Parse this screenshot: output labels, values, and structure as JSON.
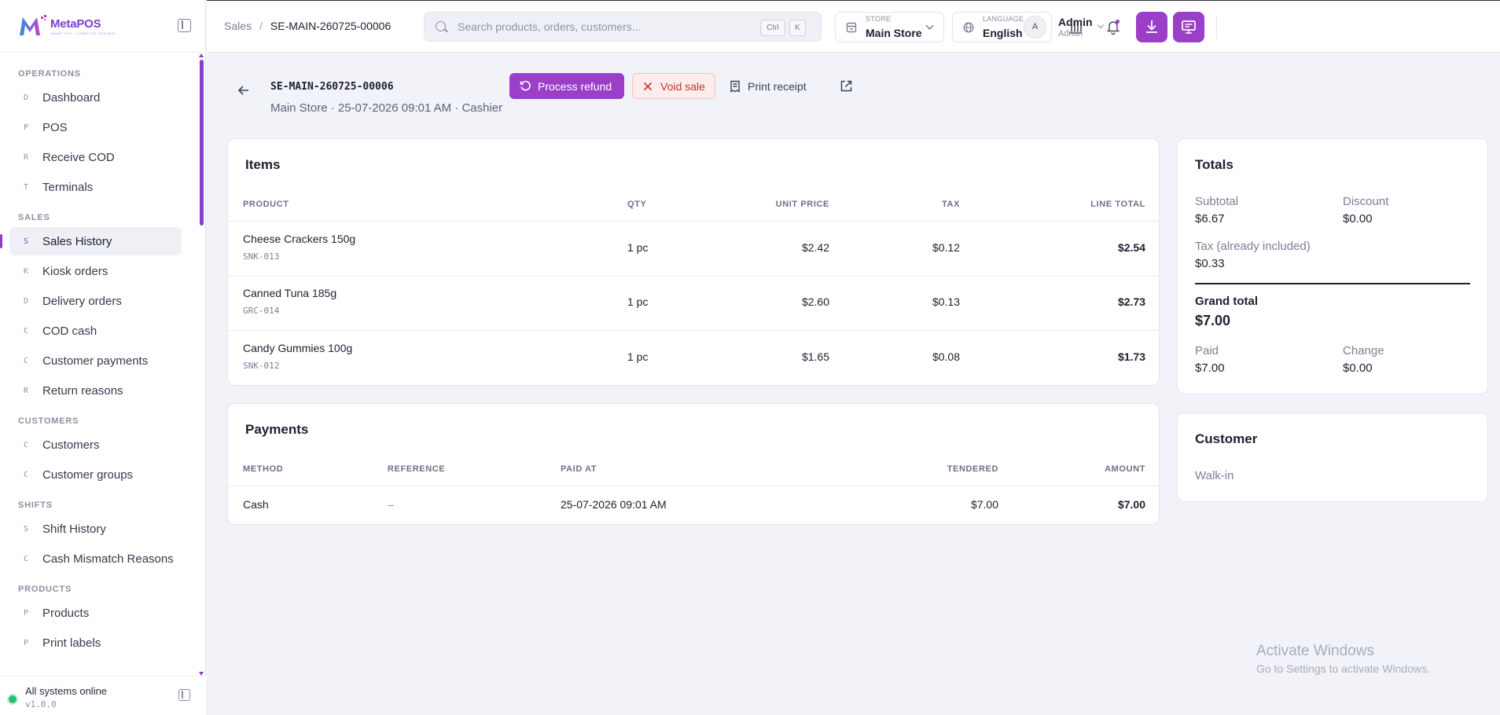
{
  "brand": {
    "name": "MetaPOS",
    "tagline": "SMART POS · COMPLETE CONTROL"
  },
  "sidebar": {
    "sections": [
      {
        "title": "OPERATIONS",
        "items": [
          {
            "letter": "D",
            "label": "Dashboard"
          },
          {
            "letter": "P",
            "label": "POS"
          },
          {
            "letter": "R",
            "label": "Receive COD"
          },
          {
            "letter": "T",
            "label": "Terminals"
          }
        ]
      },
      {
        "title": "SALES",
        "items": [
          {
            "letter": "S",
            "label": "Sales History"
          },
          {
            "letter": "K",
            "label": "Kiosk orders"
          },
          {
            "letter": "D",
            "label": "Delivery orders"
          },
          {
            "letter": "C",
            "label": "COD cash"
          },
          {
            "letter": "C",
            "label": "Customer payments"
          },
          {
            "letter": "R",
            "label": "Return reasons"
          }
        ]
      },
      {
        "title": "CUSTOMERS",
        "items": [
          {
            "letter": "C",
            "label": "Customers"
          },
          {
            "letter": "C",
            "label": "Customer groups"
          }
        ]
      },
      {
        "title": "SHIFTS",
        "items": [
          {
            "letter": "S",
            "label": "Shift History"
          },
          {
            "letter": "C",
            "label": "Cash Mismatch Reasons"
          }
        ]
      },
      {
        "title": "PRODUCTS",
        "items": [
          {
            "letter": "P",
            "label": "Products"
          },
          {
            "letter": "P",
            "label": "Print labels"
          }
        ]
      }
    ],
    "active_item": "Sales History",
    "footer": {
      "status": "All systems online",
      "version": "v1.0.0"
    }
  },
  "topbar": {
    "breadcrumb": {
      "parent": "Sales",
      "separator": "/",
      "current": "SE-MAIN-260725-00006"
    },
    "search": {
      "placeholder": "Search products, orders, customers...",
      "kbd1": "Ctrl",
      "kbd2": "K"
    },
    "store": {
      "caption": "STORE",
      "value": "Main Store"
    },
    "language": {
      "caption": "LANGUAGE",
      "value": "English"
    },
    "user": {
      "initial": "A",
      "name": "Admin",
      "role": "Admin"
    },
    "accent": "#9b3fc9"
  },
  "sale": {
    "id": "SE-MAIN-260725-00006",
    "meta": "Main Store · 25-07-2026 09:01 AM · Cashier",
    "actions": {
      "refund": "Process refund",
      "void": "Void sale",
      "print": "Print receipt"
    }
  },
  "items": {
    "title": "Items",
    "headers": [
      "PRODUCT",
      "QTY",
      "UNIT PRICE",
      "TAX",
      "LINE TOTAL"
    ],
    "rows": [
      {
        "name": "Cheese Crackers 150g",
        "sku": "SNK-013",
        "qty": "1 pc",
        "unit_price": "$2.42",
        "tax": "$0.12",
        "line_total": "$2.54"
      },
      {
        "name": "Canned Tuna 185g",
        "sku": "GRC-014",
        "qty": "1 pc",
        "unit_price": "$2.60",
        "tax": "$0.13",
        "line_total": "$2.73"
      },
      {
        "name": "Candy Gummies 100g",
        "sku": "SNK-012",
        "qty": "1 pc",
        "unit_price": "$1.65",
        "tax": "$0.08",
        "line_total": "$1.73"
      }
    ]
  },
  "payments": {
    "title": "Payments",
    "headers": [
      "METHOD",
      "REFERENCE",
      "PAID AT",
      "TENDERED",
      "AMOUNT"
    ],
    "rows": [
      {
        "method": "Cash",
        "reference": "–",
        "paid_at": "25-07-2026 09:01 AM",
        "tendered": "$7.00",
        "amount": "$7.00"
      }
    ]
  },
  "totals": {
    "title": "Totals",
    "subtotal_label": "Subtotal",
    "subtotal": "$6.67",
    "discount_label": "Discount",
    "discount": "$0.00",
    "tax_label": "Tax (already included)",
    "tax": "$0.33",
    "grand_label": "Grand total",
    "grand": "$7.00",
    "paid_label": "Paid",
    "paid": "$7.00",
    "change_label": "Change",
    "change": "$0.00"
  },
  "customer": {
    "title": "Customer",
    "value": "Walk-in"
  },
  "watermark": {
    "line1": "Activate Windows",
    "line2": "Go to Settings to activate Windows."
  }
}
